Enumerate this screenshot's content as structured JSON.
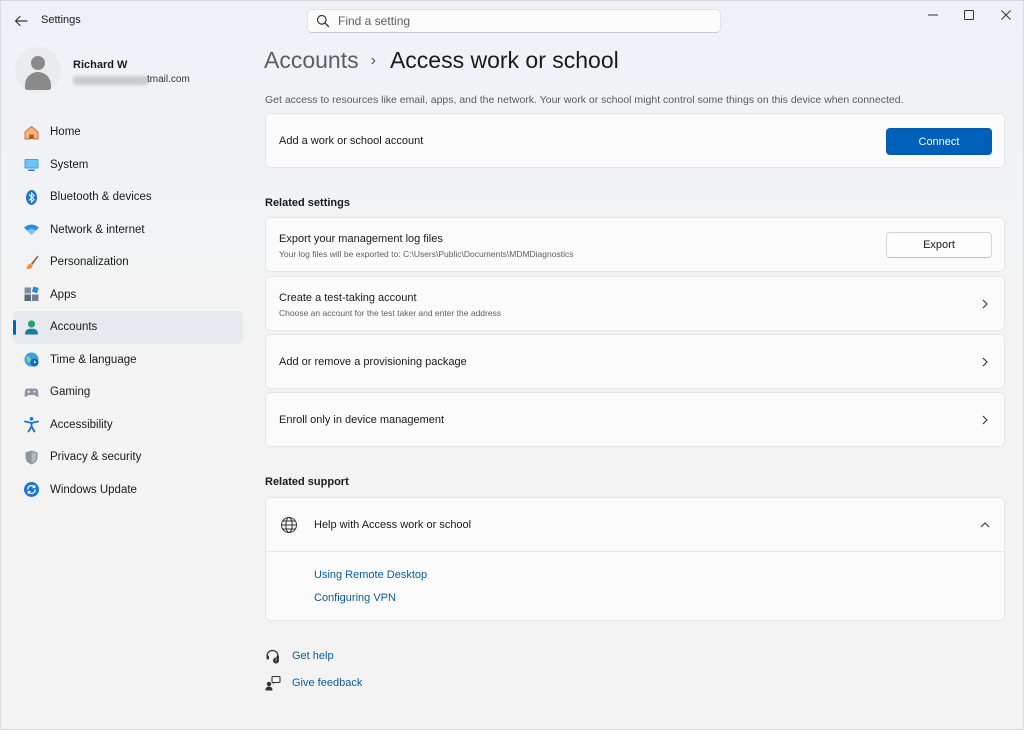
{
  "window": {
    "title": "Settings",
    "controls": {
      "minimize": "—",
      "maximize": "☐",
      "close": "✕"
    }
  },
  "search": {
    "placeholder": "Find a setting",
    "value": ""
  },
  "profile": {
    "name": "Richard W",
    "email_visible": "tmail.com"
  },
  "sidebar": {
    "items": [
      {
        "label": "Home",
        "icon": "home-icon",
        "active": false
      },
      {
        "label": "System",
        "icon": "system-icon",
        "active": false
      },
      {
        "label": "Bluetooth & devices",
        "icon": "bluetooth-icon",
        "active": false
      },
      {
        "label": "Network & internet",
        "icon": "network-icon",
        "active": false
      },
      {
        "label": "Personalization",
        "icon": "personalization-icon",
        "active": false
      },
      {
        "label": "Apps",
        "icon": "apps-icon",
        "active": false
      },
      {
        "label": "Accounts",
        "icon": "accounts-icon",
        "active": true
      },
      {
        "label": "Time & language",
        "icon": "time-language-icon",
        "active": false
      },
      {
        "label": "Gaming",
        "icon": "gaming-icon",
        "active": false
      },
      {
        "label": "Accessibility",
        "icon": "accessibility-icon",
        "active": false
      },
      {
        "label": "Privacy & security",
        "icon": "privacy-icon",
        "active": false
      },
      {
        "label": "Windows Update",
        "icon": "windows-update-icon",
        "active": false
      }
    ]
  },
  "main": {
    "breadcrumb": {
      "parent": "Accounts",
      "separator": "›",
      "current": "Access work or school"
    },
    "intro": "Get access to resources like email, apps, and the network. Your work or school might control some things on this device when connected.",
    "add_account": {
      "title": "Add a work or school account",
      "button": "Connect"
    },
    "related_settings": {
      "heading": "Related settings",
      "export_logs": {
        "title": "Export your management log files",
        "subtitle": "Your log files will be exported to: C:\\Users\\Public\\Documents\\MDMDiagnostics",
        "button": "Export"
      },
      "test_account": {
        "title": "Create a test-taking account",
        "subtitle": "Choose an account for the test taker and enter the address"
      },
      "provisioning": {
        "title": "Add or remove a provisioning package"
      },
      "enroll": {
        "title": "Enroll only in device management"
      }
    },
    "related_support": {
      "heading": "Related support",
      "help_title": "Help with Access work or school",
      "links": [
        "Using Remote Desktop",
        "Configuring VPN"
      ]
    },
    "footer": {
      "get_help": "Get help",
      "give_feedback": "Give feedback"
    }
  },
  "colors": {
    "accent": "#005fb8",
    "link": "#0a5b9c",
    "card_bg": "#fbfbfb",
    "window_bg": "#f3f3f3"
  }
}
